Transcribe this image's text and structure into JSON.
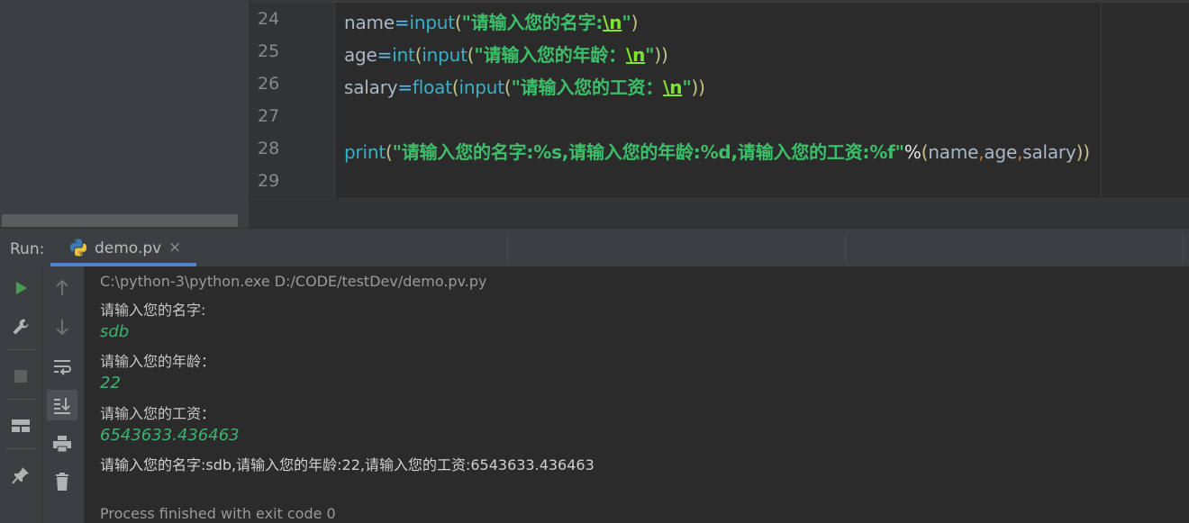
{
  "editor": {
    "lines": [
      {
        "number": "24",
        "tokens": [
          {
            "t": "name",
            "k": "ident"
          },
          {
            "t": "=",
            "k": "op"
          },
          {
            "t": "input",
            "k": "func"
          },
          {
            "t": "(",
            "k": "paren"
          },
          {
            "t": "\"请输入您的名字:",
            "k": "str"
          },
          {
            "t": "\\n",
            "k": "esc"
          },
          {
            "t": "\"",
            "k": "str"
          },
          {
            "t": ")",
            "k": "paren"
          }
        ]
      },
      {
        "number": "25",
        "tokens": [
          {
            "t": "age",
            "k": "ident"
          },
          {
            "t": "=",
            "k": "op"
          },
          {
            "t": "int",
            "k": "func"
          },
          {
            "t": "(",
            "k": "paren"
          },
          {
            "t": "input",
            "k": "func"
          },
          {
            "t": "(",
            "k": "paren"
          },
          {
            "t": "\"请输入您的年龄：",
            "k": "str"
          },
          {
            "t": "\\n",
            "k": "esc"
          },
          {
            "t": "\"",
            "k": "str"
          },
          {
            "t": "))",
            "k": "paren"
          }
        ]
      },
      {
        "number": "26",
        "tokens": [
          {
            "t": "salary",
            "k": "ident"
          },
          {
            "t": "=",
            "k": "op"
          },
          {
            "t": "float",
            "k": "func"
          },
          {
            "t": "(",
            "k": "paren"
          },
          {
            "t": "input",
            "k": "func"
          },
          {
            "t": "(",
            "k": "paren"
          },
          {
            "t": "\"请输入您的工资：",
            "k": "str"
          },
          {
            "t": "\\n",
            "k": "esc"
          },
          {
            "t": "\"",
            "k": "str"
          },
          {
            "t": "))",
            "k": "paren"
          }
        ]
      },
      {
        "number": "27",
        "tokens": []
      },
      {
        "number": "28",
        "tokens": [
          {
            "t": "print",
            "k": "func"
          },
          {
            "t": "(",
            "k": "paren"
          },
          {
            "t": "\"请输入您的名字:%s,请输入您的年龄:%d,请输入您的工资:%f\"",
            "k": "str"
          },
          {
            "t": "%",
            "k": "pct"
          },
          {
            "t": "(",
            "k": "paren"
          },
          {
            "t": "name",
            "k": "ident"
          },
          {
            "t": ",",
            "k": "comma"
          },
          {
            "t": "age",
            "k": "ident"
          },
          {
            "t": ",",
            "k": "comma"
          },
          {
            "t": "salary",
            "k": "ident"
          },
          {
            "t": "))",
            "k": "paren"
          }
        ]
      },
      {
        "number": "29",
        "tokens": []
      }
    ]
  },
  "run_panel": {
    "title": "Run:",
    "tab_label": "demo.pv",
    "tab_close": "×",
    "tab_icon": "python-icon",
    "left_toolbar": [
      "run-icon",
      "wrench-icon",
      "stop-icon",
      "layout-icon",
      "pin-icon"
    ],
    "right_toolbar": [
      "arrow-up-icon",
      "arrow-down-icon",
      "soft-wrap-icon",
      "scroll-to-end-icon",
      "print-icon",
      "trash-icon"
    ]
  },
  "console": {
    "command": "C:\\python-3\\python.exe D:/CODE/testDev/demo.pv.py",
    "prompt_name": "请输入您的名字:",
    "input_name": "sdb",
    "prompt_age": "请输入您的年龄：",
    "input_age": "22",
    "prompt_salary": "请输入您的工资：",
    "input_salary": "6543633.436463",
    "result": "请输入您的名字:sdb,请输入您的年龄:22,请输入您的工资:6543633.436463",
    "exit_message": "Process finished with exit code 0"
  },
  "colors": {
    "accent": "#4a88c7",
    "run_green": "#499c54",
    "console_input": "#3cb371"
  }
}
